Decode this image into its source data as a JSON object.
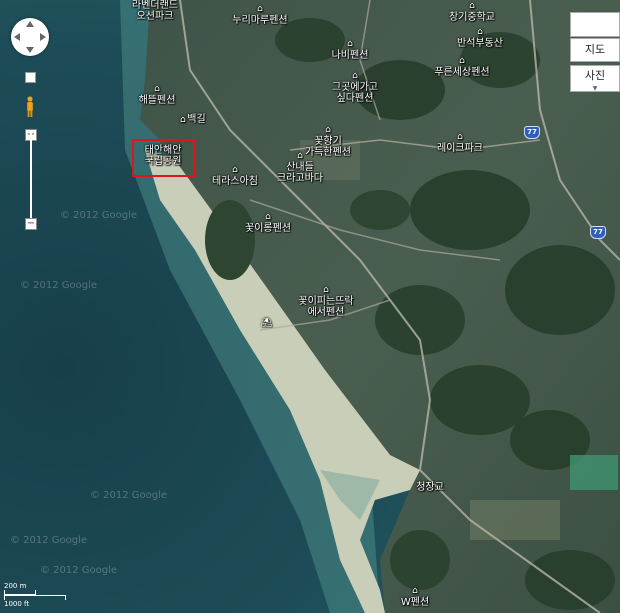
{
  "map": {
    "highlight_label": [
      "태안해안",
      "국립공원"
    ],
    "labels": [
      {
        "id": "label-lavender",
        "text": [
          "라벤더랜드",
          "오션파크"
        ],
        "pin": false
      },
      {
        "id": "label-nuri",
        "text": [
          "누리마루펜션"
        ],
        "pin": true
      },
      {
        "id": "label-changgi-school",
        "text": [
          "창기중학교"
        ],
        "pin": true
      },
      {
        "id": "label-nabi",
        "text": [
          "나비펜션"
        ],
        "pin": true
      },
      {
        "id": "label-banseok",
        "text": [
          "반석부동산"
        ],
        "pin": true
      },
      {
        "id": "label-pureun",
        "text": [
          "푸른세상펜션"
        ],
        "pin": true
      },
      {
        "id": "label-haedeul",
        "text": [
          "해뜰펜션"
        ],
        "pin": true
      },
      {
        "id": "label-gureu",
        "text": [
          "그곳에가고",
          "싶다펜션"
        ],
        "pin": true
      },
      {
        "id": "label-baekgil",
        "text": [
          "백길"
        ],
        "pin": true
      },
      {
        "id": "label-kkot",
        "text": [
          "꽃향기",
          "가득한펜션"
        ],
        "pin": true
      },
      {
        "id": "label-lake",
        "text": [
          "레이크파크"
        ],
        "pin": true
      },
      {
        "id": "label-sanneul",
        "text": [
          "산내들",
          "크라고바다"
        ],
        "pin": true
      },
      {
        "id": "label-terrace",
        "text": [
          "테라스아침"
        ],
        "pin": true
      },
      {
        "id": "label-kkoti",
        "text": [
          "꽃이롱펜션"
        ],
        "pin": true
      },
      {
        "id": "label-kkotipi",
        "text": [
          "꽃이피는뜨락",
          "에서펜션"
        ],
        "pin": true
      },
      {
        "id": "label-chongjang",
        "text": [
          "청장교"
        ],
        "pin": false
      },
      {
        "id": "label-w",
        "text": [
          "W펜션"
        ],
        "pin": true
      }
    ],
    "route_shields": [
      "77",
      "77"
    ],
    "watermarks": [
      "© 2012 Google",
      "© 2012 Google",
      "© 2012 Google",
      "© 2012 Google",
      "© 2012 Google"
    ]
  },
  "controls": {
    "map_button": "지도",
    "photo_button": "사진",
    "zoom_in": "+",
    "zoom_out": "−"
  },
  "scale": {
    "metric": "200 m",
    "imperial": "1000 ft"
  }
}
